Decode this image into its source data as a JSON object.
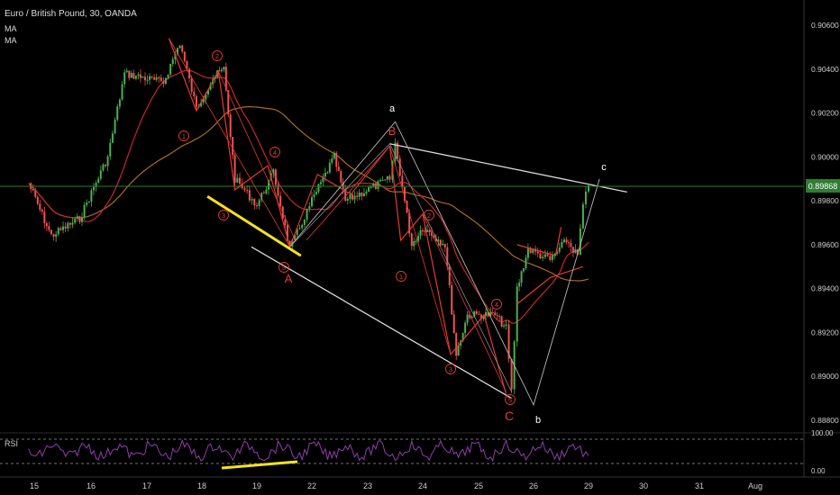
{
  "header": {
    "symbol_line": "Euro / British Pound, 30, OANDA",
    "indicator_1": "MA",
    "indicator_2": "MA"
  },
  "rsi": {
    "label": "RSI",
    "levels": [
      "100.00",
      "0.00"
    ]
  },
  "colors": {
    "background": "#000000",
    "up_candle": "#4caf50",
    "down_candle": "#ef5350",
    "ma_red": "#c62828",
    "ma_orange": "#a96b22",
    "wave_red": "#e53935",
    "white_line": "#d9d9d9",
    "yellow": "#f5e31a",
    "rsi_line": "#8e3fa8",
    "price_badge": "#2e7d32"
  },
  "chart_data": {
    "type": "candlestick",
    "title": "Euro / British Pound, 30, OANDA",
    "ylim": [
      0.8874,
      0.9072
    ],
    "y_ticks": [
      "0.90600",
      "0.90400",
      "0.90200",
      "0.90000",
      "0.89800",
      "0.89600",
      "0.89400",
      "0.89200",
      "0.89000",
      "0.88800"
    ],
    "x_ticks": [
      "15",
      "16",
      "17",
      "18",
      "19",
      "22",
      "23",
      "24",
      "25",
      "26",
      "29",
      "30",
      "31",
      "Aug"
    ],
    "last_price": "0.89868",
    "grid": false,
    "price_path_anchors": [
      {
        "x": "14.9",
        "price": 0.8988
      },
      {
        "x": "15.3",
        "price": 0.8964
      },
      {
        "x": "15.8",
        "price": 0.8972
      },
      {
        "x": "16.3",
        "price": 0.9
      },
      {
        "x": "16.6",
        "price": 0.9038
      },
      {
        "x": "17.3",
        "price": 0.9034
      },
      {
        "x": "17.6",
        "price": 0.9052
      },
      {
        "x": "17.9",
        "price": 0.9022
      },
      {
        "x": "18.2",
        "price": 0.9036
      },
      {
        "x": "18.4",
        "price": 0.904
      },
      {
        "x": "18.6",
        "price": 0.899
      },
      {
        "x": "19.0",
        "price": 0.8978
      },
      {
        "x": "19.3",
        "price": 0.8993
      },
      {
        "x": "19.6",
        "price": 0.8958
      },
      {
        "x": "21.8",
        "price": 0.898
      },
      {
        "x": "22.4",
        "price": 0.9
      },
      {
        "x": "22.6",
        "price": 0.898
      },
      {
        "x": "23.4",
        "price": 0.899
      },
      {
        "x": "23.5",
        "price": 0.9006
      },
      {
        "x": "23.8",
        "price": 0.896
      },
      {
        "x": "24.0",
        "price": 0.8968
      },
      {
        "x": "24.4",
        "price": 0.896
      },
      {
        "x": "24.6",
        "price": 0.891
      },
      {
        "x": "24.8",
        "price": 0.8928
      },
      {
        "x": "25.3",
        "price": 0.8928
      },
      {
        "x": "25.5",
        "price": 0.8922
      },
      {
        "x": "25.6",
        "price": 0.8893
      },
      {
        "x": "25.7",
        "price": 0.894
      },
      {
        "x": "25.9",
        "price": 0.8958
      },
      {
        "x": "26.3",
        "price": 0.8953
      },
      {
        "x": "26.6",
        "price": 0.8962
      },
      {
        "x": "26.8",
        "price": 0.8955
      },
      {
        "x": "26.9",
        "price": 0.8978
      },
      {
        "x": "29.0",
        "price": 0.8987
      }
    ],
    "annotations": {
      "wave_letters": [
        "a",
        "B",
        "A",
        "C",
        "b",
        "c"
      ],
      "wave_numbers": [
        "1",
        "2",
        "3",
        "4",
        "5",
        "1",
        "2",
        "3",
        "4",
        "5"
      ]
    }
  }
}
